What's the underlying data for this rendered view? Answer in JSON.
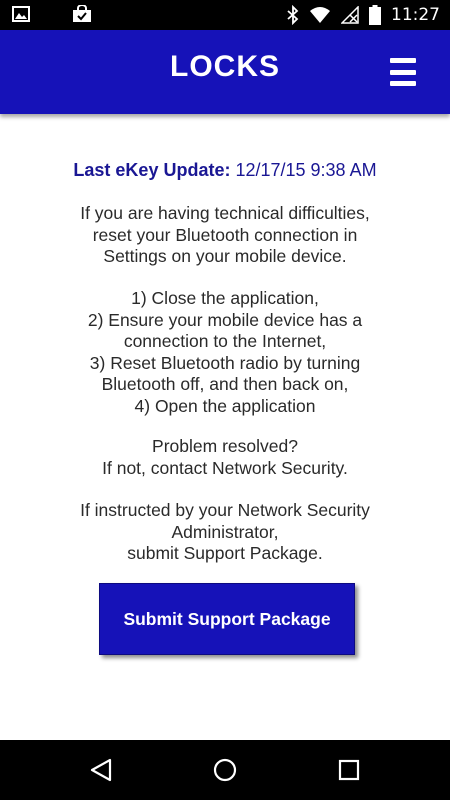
{
  "status_bar": {
    "time": "11:27",
    "icons": [
      "image-icon",
      "shopping-bag-icon",
      "bluetooth-icon",
      "wifi-icon",
      "no-signal-icon",
      "battery-icon"
    ]
  },
  "header": {
    "title": "LOCKS",
    "menu_icon": "hamburger-menu-icon",
    "background_color": "#1612b8"
  },
  "main": {
    "last_update": {
      "label": "Last eKey Update:",
      "value": "12/17/15 9:38 AM"
    },
    "paragraph_1": [
      "If you are having technical difficulties,",
      "reset your Bluetooth connection in",
      "Settings on your mobile device."
    ],
    "steps": [
      "1) Close the application,",
      "2) Ensure your mobile device has a",
      "connection to the Internet,",
      "3) Reset Bluetooth radio by turning",
      "Bluetooth off, and then back on,",
      "4) Open the application"
    ],
    "paragraph_3": [
      "Problem resolved?",
      "If not, contact Network Security."
    ],
    "paragraph_4": [
      "If instructed by your Network Security",
      "Administrator,",
      "submit Support Package."
    ],
    "submit_button_label": "Submit Support Package"
  },
  "nav_bar": {
    "icons": [
      "back-icon",
      "home-icon",
      "recent-apps-icon"
    ]
  }
}
